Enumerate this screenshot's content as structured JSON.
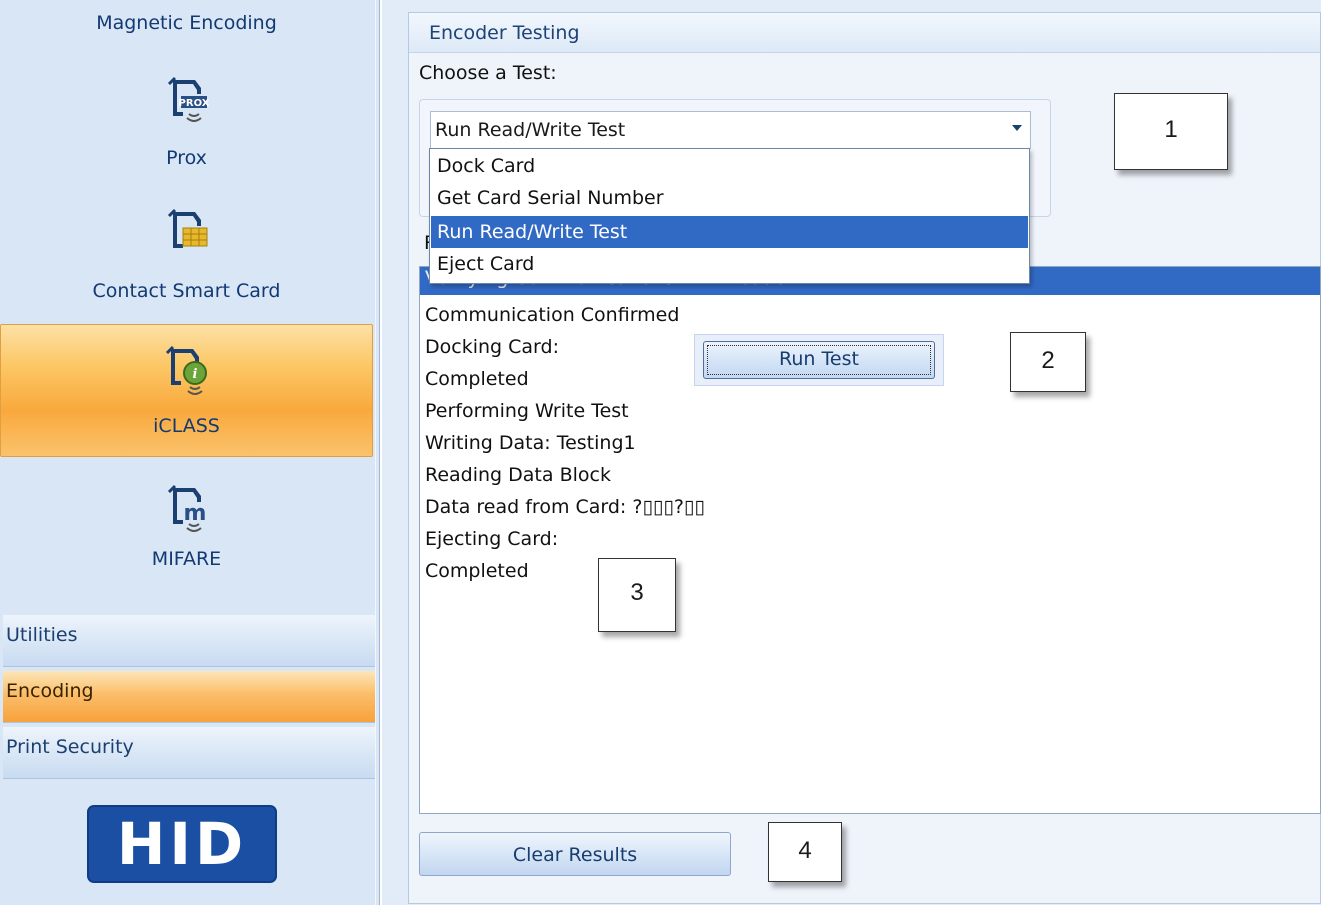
{
  "sidebar": {
    "items": [
      {
        "label": "Magnetic Encoding",
        "icon": "magnetic-encoding-icon"
      },
      {
        "label": "Prox",
        "icon": "prox-card-icon"
      },
      {
        "label": "Contact Smart Card",
        "icon": "contact-smart-card-icon"
      },
      {
        "label": "iCLASS",
        "icon": "iclass-card-icon",
        "selected": true
      },
      {
        "label": "MIFARE",
        "icon": "mifare-card-icon"
      }
    ],
    "groups": [
      {
        "label": "Utilities"
      },
      {
        "label": "Encoding",
        "selected": true
      },
      {
        "label": "Print Security"
      }
    ],
    "logo_text": "HID"
  },
  "panel": {
    "title": "Encoder Testing",
    "choose_label": "Choose a Test:",
    "combo_value": "Run Read/Write Test",
    "dropdown_options": [
      "Dock Card",
      "Get Card Serial Number",
      "Run Read/Write Test",
      "Eject Card"
    ],
    "dropdown_selected_index": 2,
    "results_label_partial": "R",
    "results": [
      "Verifying Communications with Reader",
      "Communication Confirmed",
      "Docking Card:",
      "Completed",
      "Performing Write Test",
      "Writing Data: Testing1",
      "Reading Data Block",
      "Data read from Card: ?▯▯▯?▯▯",
      "Ejecting Card:",
      "Completed"
    ],
    "run_test_label": "Run Test",
    "clear_results_label": "Clear Results"
  },
  "callouts": [
    "1",
    "2",
    "3",
    "4"
  ],
  "colors": {
    "selection_blue": "#316ac5",
    "sidebar_bg": "#d9e6f5",
    "selected_orange": "#f9a93c",
    "hid_blue": "#1a4fa3"
  }
}
